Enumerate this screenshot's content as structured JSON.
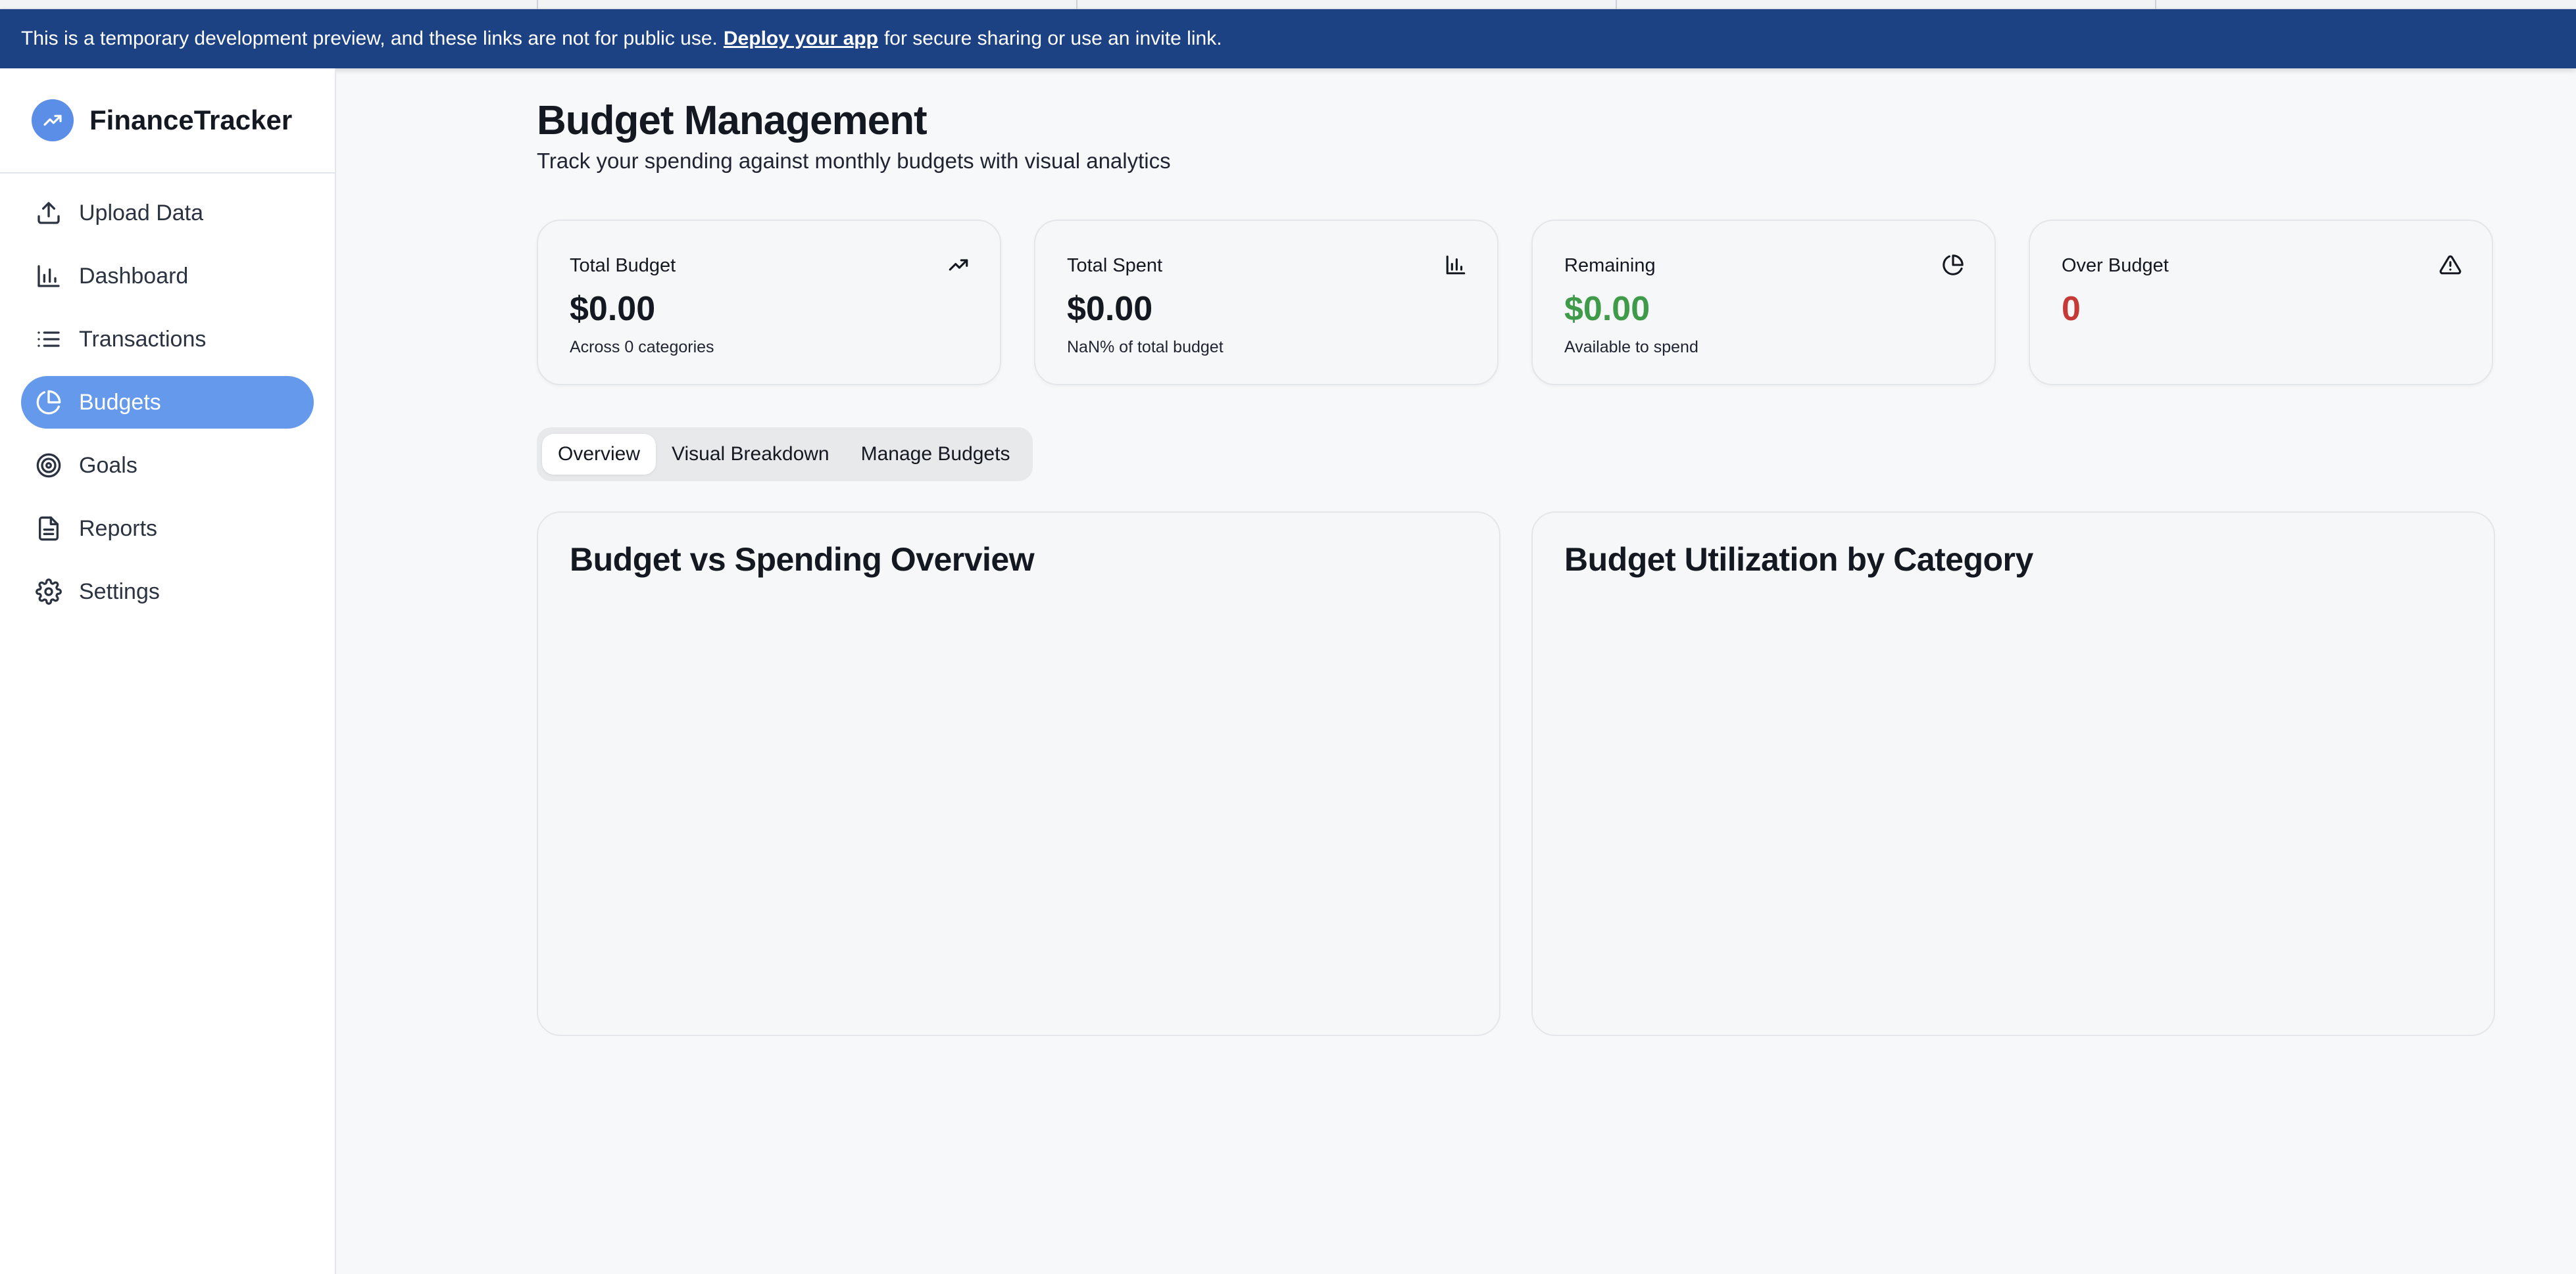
{
  "banner": {
    "text_before": "This is a temporary development preview, and these links are not for public use.",
    "link": "Deploy your app",
    "text_after": "for secure sharing or use an invite link."
  },
  "brand": {
    "name": "FinanceTracker",
    "icon": "trending-up-icon"
  },
  "sidebar": {
    "items": [
      {
        "label": "Upload Data",
        "icon": "upload-icon",
        "active": false
      },
      {
        "label": "Dashboard",
        "icon": "bar-chart-icon",
        "active": false
      },
      {
        "label": "Transactions",
        "icon": "list-icon",
        "active": false
      },
      {
        "label": "Budgets",
        "icon": "pie-chart-icon",
        "active": true
      },
      {
        "label": "Goals",
        "icon": "target-icon",
        "active": false
      },
      {
        "label": "Reports",
        "icon": "file-text-icon",
        "active": false
      },
      {
        "label": "Settings",
        "icon": "gear-icon",
        "active": false
      }
    ]
  },
  "page": {
    "title": "Budget Management",
    "subtitle": "Track your spending against monthly budgets with visual analytics"
  },
  "cards": [
    {
      "label": "Total Budget",
      "value": "$0.00",
      "sub": "Across 0 categories",
      "icon": "trending-up-icon",
      "color": "#141820"
    },
    {
      "label": "Total Spent",
      "value": "$0.00",
      "sub": "NaN% of total budget",
      "icon": "bar-chart-icon",
      "color": "#141820"
    },
    {
      "label": "Remaining",
      "value": "$0.00",
      "sub": "Available to spend",
      "icon": "pie-chart-icon",
      "color": "#3f9a4a"
    },
    {
      "label": "Over Budget",
      "value": "0",
      "sub": "",
      "icon": "alert-triangle-icon",
      "color": "#c53a36"
    }
  ],
  "tabs": [
    {
      "label": "Overview",
      "active": true
    },
    {
      "label": "Visual Breakdown",
      "active": false
    },
    {
      "label": "Manage Budgets",
      "active": false
    }
  ],
  "panels": [
    {
      "title": "Budget vs Spending Overview"
    },
    {
      "title": "Budget Utilization by Category"
    }
  ],
  "colors": {
    "banner_bg": "#1d4283",
    "accent": "#6499ec",
    "positive": "#3f9a4a",
    "negative": "#c53a36"
  }
}
